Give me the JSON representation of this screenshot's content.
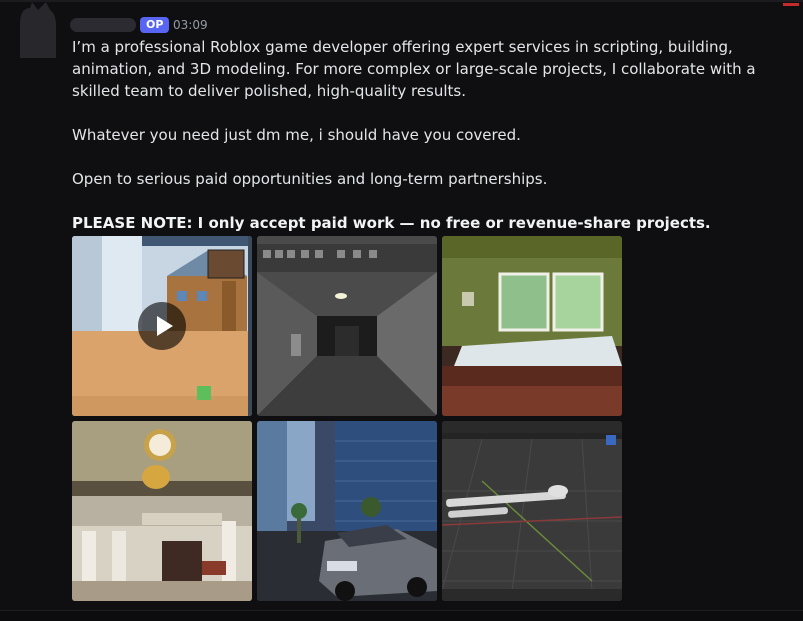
{
  "post": {
    "badge": "OP",
    "time": "03:09",
    "paragraphs": [
      "I’m a professional Roblox game developer offering expert services in scripting, building, animation, and 3D modeling. For more complex or large-scale projects, I collaborate with a skilled team to deliver polished, high-quality results.",
      "Whatever you need just dm me, i should have you covered.",
      "Open to serious paid opportunities and long-term partnerships."
    ],
    "note": "PLEASE NOTE: I only accept paid work — no free or revenue-share projects."
  },
  "attachments": [
    {
      "kind": "video",
      "subject": "roblox-town-gameplay"
    },
    {
      "kind": "image",
      "subject": "dark-corridor-build"
    },
    {
      "kind": "image",
      "subject": "office-room-build"
    },
    {
      "kind": "image",
      "subject": "ornate-hall-build"
    },
    {
      "kind": "image",
      "subject": "city-car-scene"
    },
    {
      "kind": "image",
      "subject": "rocket-launcher-model"
    }
  ],
  "colors": {
    "badge": "#5865f2",
    "background": "#0f0f12",
    "text": "#e3e5e8"
  }
}
